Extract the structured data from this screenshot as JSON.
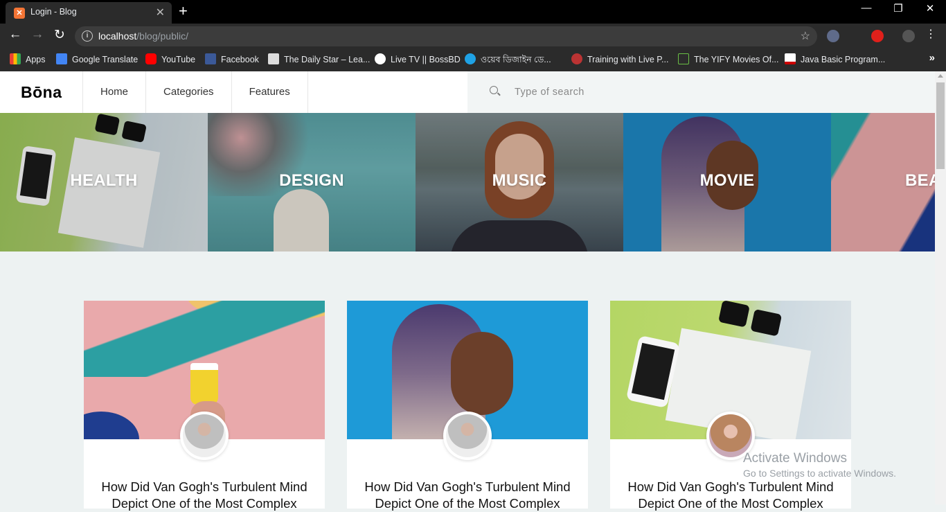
{
  "browser": {
    "tab_title": "Login - Blog",
    "url_host": "localhost",
    "url_path": "/blog/public/",
    "bookmarks": [
      {
        "label": "Apps",
        "icon": "apps-grid-icon"
      },
      {
        "label": "Google Translate",
        "icon": "google-translate-icon"
      },
      {
        "label": "YouTube",
        "icon": "youtube-icon"
      },
      {
        "label": "Facebook",
        "icon": "facebook-icon"
      },
      {
        "label": "The Daily Star – Lea...",
        "icon": "daily-star-icon"
      },
      {
        "label": "Live TV || BossBD",
        "icon": "globe-icon"
      },
      {
        "label": "ওয়েব ডিজাইন ডে...",
        "icon": "web-design-icon"
      },
      {
        "label": "Training with Live P...",
        "icon": "training-icon"
      },
      {
        "label": "The YIFY Movies Of...",
        "icon": "yify-icon"
      },
      {
        "label": "Java Basic Program...",
        "icon": "java-icon"
      }
    ]
  },
  "header": {
    "logo": "Bōna",
    "nav": [
      "Home",
      "Categories",
      "Features"
    ],
    "search_placeholder": "Type of search"
  },
  "categories": [
    "HEALTH",
    "DESIGN",
    "MUSIC",
    "MOVIE",
    "BEA"
  ],
  "posts": [
    {
      "title_line1": "How Did Van Gogh's Turbulent Mind",
      "title_line2": "Depict One of the Most Complex"
    },
    {
      "title_line1": "How Did Van Gogh's Turbulent Mind",
      "title_line2": "Depict One of the Most Complex"
    },
    {
      "title_line1": "How Did Van Gogh's Turbulent Mind",
      "title_line2": "Depict One of the Most Complex"
    }
  ],
  "watermark": {
    "title": "Activate Windows",
    "subtitle": "Go to Settings to activate Windows."
  }
}
